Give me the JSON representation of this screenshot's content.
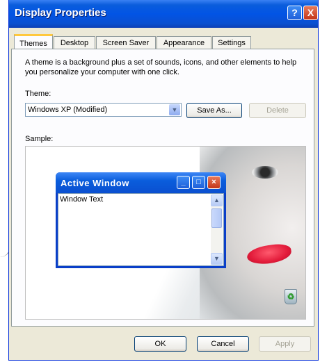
{
  "window": {
    "title": "Display Properties",
    "help_label": "?",
    "close_label": "X"
  },
  "tabs": [
    {
      "label": "Themes",
      "active": true
    },
    {
      "label": "Desktop",
      "active": false
    },
    {
      "label": "Screen Saver",
      "active": false
    },
    {
      "label": "Appearance",
      "active": false
    },
    {
      "label": "Settings",
      "active": false
    }
  ],
  "themes_page": {
    "description": "A theme is a background plus a set of sounds, icons, and other elements to help you personalize your computer with one click.",
    "theme_label": "Theme:",
    "theme_value": "Windows XP (Modified)",
    "save_as_label": "Save As...",
    "delete_label": "Delete",
    "sample_label": "Sample:"
  },
  "sample_window": {
    "title": "Active Window",
    "body_text": "Window Text"
  },
  "footer": {
    "ok_label": "OK",
    "cancel_label": "Cancel",
    "apply_label": "Apply"
  },
  "colors": {
    "titlebar": "#0a5ddc",
    "face": "#ece9d8",
    "active_tab_accent": "#ffc83c"
  },
  "icons": [
    "help-icon",
    "close-icon",
    "dropdown-arrow-icon",
    "minimize-icon",
    "maximize-icon",
    "recycle-bin-icon",
    "scroll-up-icon",
    "scroll-down-icon"
  ]
}
